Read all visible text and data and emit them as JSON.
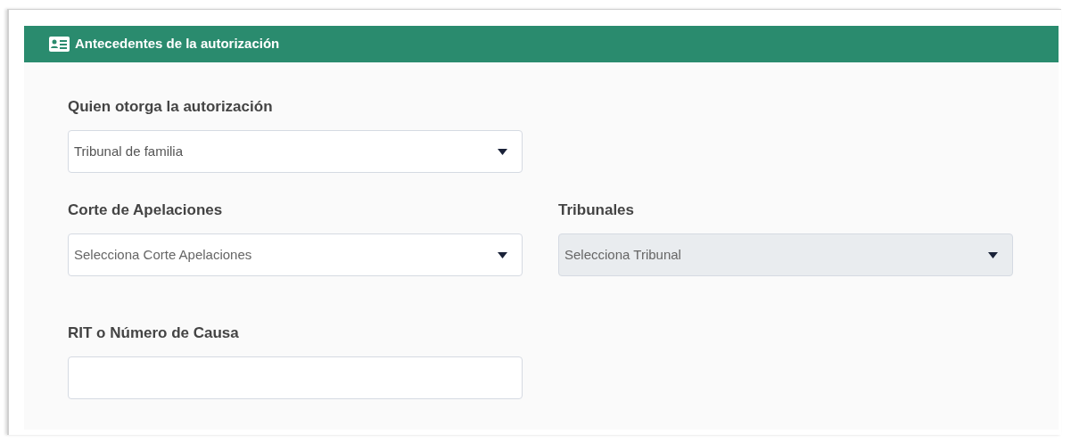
{
  "panel": {
    "title": "Antecedentes de la autorización"
  },
  "rows": [
    [
      {
        "kind": "select",
        "label": "Quien otorga la autorización",
        "value": "Tribunal de familia",
        "disabled": false
      }
    ],
    [
      {
        "kind": "select",
        "label": "Corte de Apelaciones",
        "placeholder": "Selecciona Corte Apelaciones",
        "disabled": false
      },
      {
        "kind": "select",
        "label": "Tribunales",
        "placeholder": "Selecciona Tribunal",
        "disabled": true
      }
    ],
    [
      {
        "kind": "text",
        "label": "RIT o Número de Causa",
        "disabled": false
      }
    ]
  ]
}
